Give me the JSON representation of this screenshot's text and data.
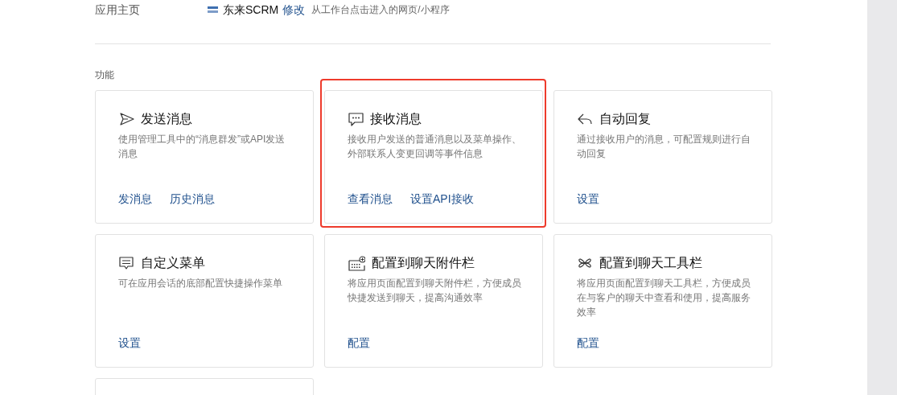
{
  "homepage": {
    "label": "应用主页",
    "app_name": "东来SCRM",
    "edit_link": "修改",
    "hint": "从工作台点击进入的网页/小程序"
  },
  "section_title": "功能",
  "cards": [
    {
      "title": "发送消息",
      "description": "使用管理工具中的“消息群发”或API发送消息",
      "links": [
        "发消息",
        "历史消息"
      ],
      "highlighted": false
    },
    {
      "title": "接收消息",
      "description": "接收用户发送的普通消息以及菜单操作、外部联系人变更回调等事件信息",
      "links": [
        "查看消息",
        "设置API接收"
      ],
      "highlighted": true
    },
    {
      "title": "自动回复",
      "description": "通过接收用户的消息，可配置规则进行自动回复",
      "links": [
        "设置"
      ],
      "highlighted": false
    },
    {
      "title": "自定义菜单",
      "description": "可在应用会话的底部配置快捷操作菜单",
      "links": [
        "设置"
      ],
      "highlighted": false
    },
    {
      "title": "配置到聊天附件栏",
      "description": "将应用页面配置到聊天附件栏，方便成员快捷发送到聊天，提高沟通效率",
      "links": [
        "配置"
      ],
      "highlighted": false
    },
    {
      "title": "配置到聊天工具栏",
      "description": "将应用页面配置到聊天工具栏，方便成员在与客户的聊天中查看和使用，提高服务效率",
      "links": [
        "配置"
      ],
      "highlighted": false
    }
  ]
}
